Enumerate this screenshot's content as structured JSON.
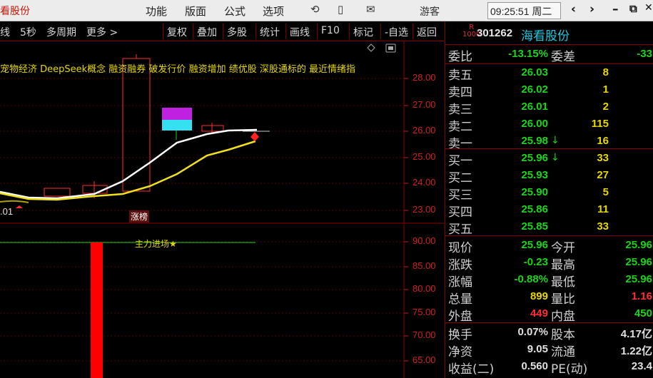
{
  "window": {
    "app_title": "看股份",
    "menu": [
      "功能",
      "版面",
      "公式",
      "选项"
    ],
    "guest": "游客",
    "clock": "09:25:51 周二",
    "win_buttons": [
      "‹",
      "›",
      "–",
      "⧉",
      "✕"
    ]
  },
  "toolbar": {
    "left": [
      "线",
      "5秒",
      "多周期",
      "更多 >"
    ],
    "right": [
      "复权",
      "叠加",
      "多股",
      "统计",
      "画线",
      "F10",
      "标记",
      "-自选",
      "返回"
    ]
  },
  "chart": {
    "concepts": "宠物经济 DeepSeek概念 融资融券 破发行价 融资增加 绩优股 深股通标的 最近情绪指",
    "price_axis": [
      "28.00",
      "27.00",
      "26.00",
      "25.00",
      "24.00",
      "23.00"
    ],
    "lower_axis": [
      "90.00",
      "85.00",
      "80.00",
      "75.00",
      "70.00",
      "65.00"
    ],
    "low_mark": ".01",
    "tag_limit_up": "涨榜",
    "tag_main_force": "主力进场★",
    "colors": {
      "up": "#ff3030",
      "down": "#19d619",
      "ma1": "#ffffff",
      "ma2": "#f0e020"
    }
  },
  "panel": {
    "badge": "R\n1000",
    "code": "301262",
    "name": "海看股份",
    "wei_bi_label": "委比",
    "wei_bi": "-13.15%",
    "wei_cha_label": "委差",
    "wei_cha": "-33",
    "asks": [
      {
        "label": "卖五",
        "price": "26.03",
        "vol": "8"
      },
      {
        "label": "卖四",
        "price": "26.02",
        "vol": "1"
      },
      {
        "label": "卖三",
        "price": "26.01",
        "vol": "2"
      },
      {
        "label": "卖二",
        "price": "26.00",
        "vol": "115"
      },
      {
        "label": "卖一",
        "price": "25.98",
        "vol": "16",
        "arrow": "↓"
      }
    ],
    "bids": [
      {
        "label": "买一",
        "price": "25.96",
        "vol": "33",
        "arrow": "↓"
      },
      {
        "label": "买二",
        "price": "25.93",
        "vol": "27"
      },
      {
        "label": "买三",
        "price": "25.90",
        "vol": "5"
      },
      {
        "label": "买四",
        "price": "25.86",
        "vol": "11"
      },
      {
        "label": "买五",
        "price": "25.85",
        "vol": "33"
      }
    ],
    "stats1": [
      {
        "l1": "现价",
        "v1": "25.96",
        "c1": "g",
        "l2": "今开",
        "v2": "25.96",
        "c2": "g"
      },
      {
        "l1": "涨跌",
        "v1": "-0.23",
        "c1": "g",
        "l2": "最高",
        "v2": "25.96",
        "c2": "g"
      },
      {
        "l1": "涨幅",
        "v1": "-0.88%",
        "c1": "g",
        "l2": "最低",
        "v2": "25.96",
        "c2": "g"
      },
      {
        "l1": "总量",
        "v1": "899",
        "c1": "y",
        "l2": "量比",
        "v2": "1.16",
        "c2": "r"
      },
      {
        "l1": "外盘",
        "v1": "449",
        "c1": "r",
        "l2": "内盘",
        "v2": "450",
        "c2": "g"
      }
    ],
    "stats2": [
      {
        "l1": "换手",
        "v1": "0.07%",
        "c1": "w",
        "l2": "股本",
        "v2": "4.17亿",
        "c2": "w"
      },
      {
        "l1": "净资",
        "v1": "9.05",
        "c1": "w",
        "l2": "流通",
        "v2": "1.22亿",
        "c2": "w"
      },
      {
        "l1": "收益(二)",
        "v1": "0.560",
        "c1": "w",
        "l2": "PE(动)",
        "v2": "23.4",
        "c2": "w"
      }
    ]
  }
}
